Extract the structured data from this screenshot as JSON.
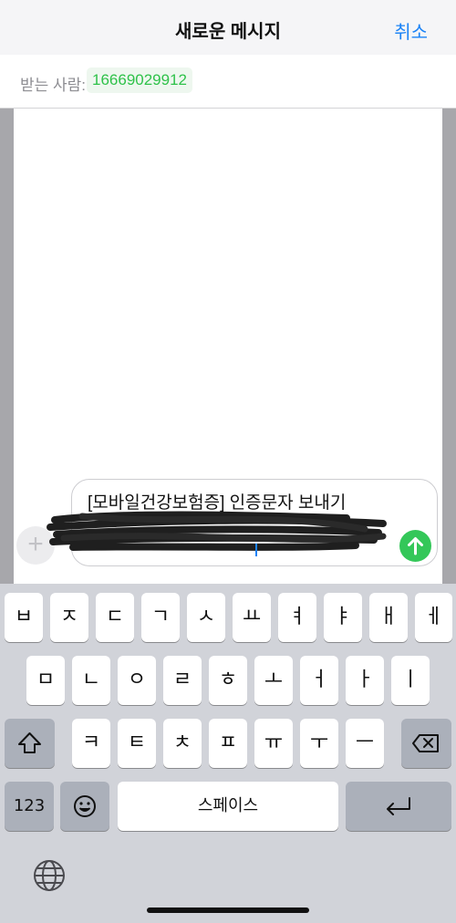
{
  "header": {
    "title": "새로운 메시지",
    "cancel_label": "취소"
  },
  "recipient": {
    "label": "받는 사람:",
    "value": "16669029912"
  },
  "composer": {
    "text": "[모바일건강보험증] 인증문자 보내기"
  },
  "keyboard": {
    "row1": [
      "ㅂ",
      "ㅈ",
      "ㄷ",
      "ㄱ",
      "ㅅ",
      "ㅛ",
      "ㅕ",
      "ㅑ",
      "ㅐ",
      "ㅔ"
    ],
    "row2": [
      "ㅁ",
      "ㄴ",
      "ㅇ",
      "ㄹ",
      "ㅎ",
      "ㅗ",
      "ㅓ",
      "ㅏ",
      "ㅣ"
    ],
    "row3": [
      "ㅋ",
      "ㅌ",
      "ㅊ",
      "ㅍ",
      "ㅠ",
      "ㅜ",
      "ㅡ"
    ],
    "numbers_label": "123",
    "space_label": "스페이스"
  },
  "colors": {
    "accent": "#1a82f6",
    "recipient": "#2fc24a",
    "send": "#34c759"
  },
  "icons": [
    "shift-icon",
    "backspace-icon",
    "emoji-icon",
    "return-icon",
    "globe-icon",
    "send-icon",
    "plus-icon"
  ]
}
